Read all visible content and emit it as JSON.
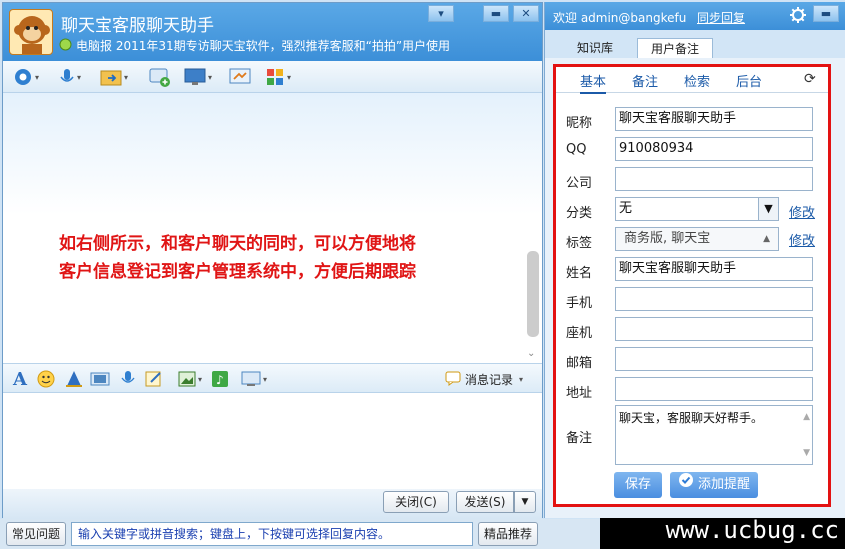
{
  "chat": {
    "title": "聊天宝客服聊天助手",
    "subtitle": "电脑报 2011年31期专访聊天宝软件，强烈推荐客服和“拍拍”用户使用",
    "message_line1": "如右侧所示，和客户聊天的同时，可以方便地将",
    "message_line2": "客户信息登记到客户管理系统中，方便后期跟踪",
    "history_label": "消息记录",
    "close_label": "关闭(C)",
    "send_label": "发送(S)"
  },
  "bottom": {
    "faq_label": "常见问题",
    "tip": "输入关键字或拼音搜索；键盘上，下按键可选择回复内容。",
    "featured_label": "精品推荐",
    "watermark": "www.ucbug.cc"
  },
  "panel": {
    "welcome": "欢迎 admin@bangkefu",
    "sync_label": "同步回复",
    "tabs": [
      "知识库",
      "用户备注"
    ],
    "subtabs": [
      "基本",
      "备注",
      "检索",
      "后台"
    ],
    "fields": {
      "nickname_label": "昵称",
      "nickname_value": "聊天宝客服聊天助手",
      "qq_label": "QQ",
      "qq_value": "910080934",
      "company_label": "公司",
      "company_value": "",
      "category_label": "分类",
      "category_value": "无",
      "tag_label": "标签",
      "tag_value": "商务版, 聊天宝",
      "name_label": "姓名",
      "name_value": "聊天宝客服聊天助手",
      "mobile_label": "手机",
      "mobile_value": "",
      "phone_label": "座机",
      "phone_value": "",
      "email_label": "邮箱",
      "email_value": "",
      "address_label": "地址",
      "address_value": "",
      "note_label": "备注",
      "note_value": "聊天宝，客服聊天好帮手。"
    },
    "edit_label": "修改",
    "save_label": "保存",
    "reminder_label": "添加提醒"
  },
  "colors": {
    "accent": "#3c8fd8",
    "highlight": "#e31212",
    "link": "#1b5aa8"
  }
}
